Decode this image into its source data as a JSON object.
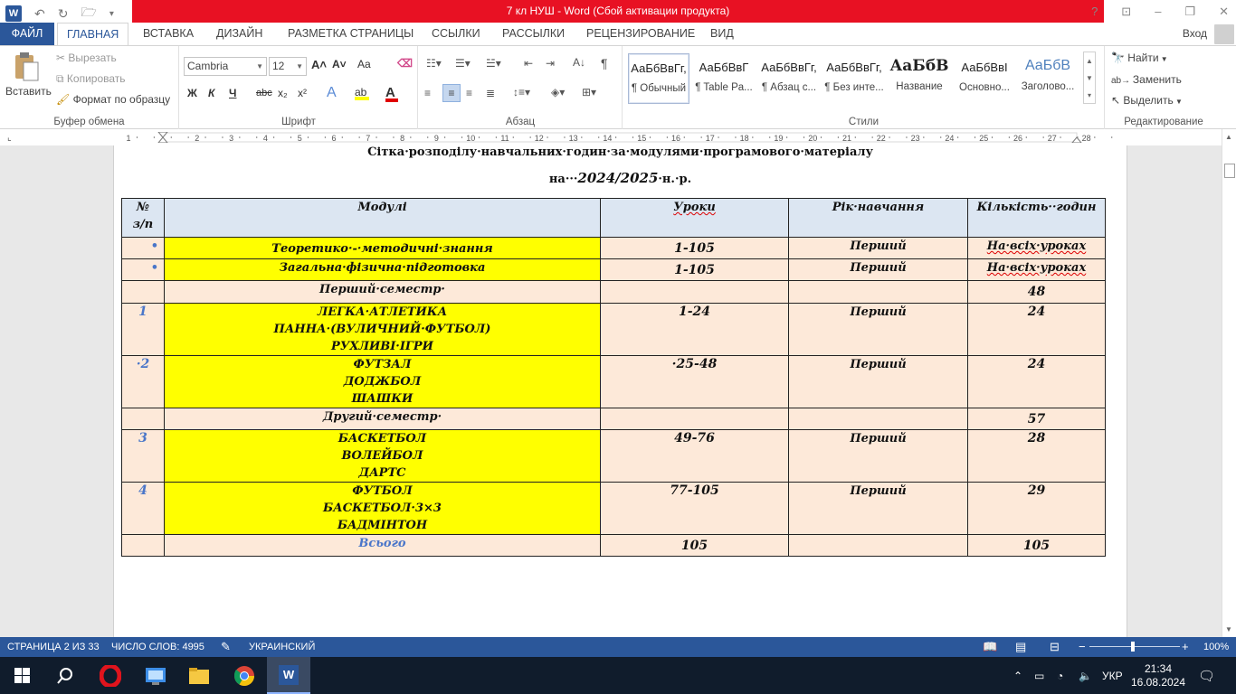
{
  "titlebar": {
    "title": "7 кл НУШ -  Word (Сбой активации продукта)",
    "help": "?",
    "ribbon_opts": "⊡",
    "minimize": "–",
    "restore": "❐",
    "close": "✕"
  },
  "tabs": {
    "file": "ФАЙЛ",
    "items": [
      "ГЛАВНАЯ",
      "ВСТАВКА",
      "ДИЗАЙН",
      "РАЗМЕТКА СТРАНИЦЫ",
      "ССЫЛКИ",
      "РАССЫЛКИ",
      "РЕЦЕНЗИРОВАНИЕ",
      "ВИД"
    ],
    "signin": "Вход"
  },
  "ribbon": {
    "clipboard": {
      "paste": "Вставить",
      "cut": "Вырезать",
      "copy": "Копировать",
      "format_painter": "Формат по образцу",
      "label": "Буфер обмена"
    },
    "font": {
      "font_name": "Cambria",
      "font_size": "12",
      "label": "Шрифт",
      "bold": "Ж",
      "italic": "К",
      "underline": "Ч",
      "strike": "abc",
      "sub": "x₂",
      "sup": "x²",
      "grow": "A˄",
      "shrink": "A˅",
      "case": "Aa",
      "effects": "A",
      "color": "A"
    },
    "paragraph": {
      "label": "Абзац",
      "pilcrow": "¶"
    },
    "styles": {
      "label": "Стили",
      "items": [
        {
          "sample": "АаБбВвГг,",
          "name": "¶ Обычный"
        },
        {
          "sample": "АаБбВвГ",
          "name": "¶ Table Pa..."
        },
        {
          "sample": "АаБбВвГг,",
          "name": "¶ Абзац с..."
        },
        {
          "sample": "АаБбВвГг,",
          "name": "¶ Без инте..."
        },
        {
          "sample": "АаБбВ",
          "name": "Название"
        },
        {
          "sample": "АаБбВвІ",
          "name": "Основно..."
        },
        {
          "sample": "АаБбВ",
          "name": "Заголово..."
        }
      ]
    },
    "editing": {
      "find": "Найти",
      "replace": "Заменить",
      "select": "Выделить",
      "label": "Редактирование"
    }
  },
  "ruler": {
    "numbers": [
      "1",
      "1",
      "2",
      "3",
      "4",
      "5",
      "6",
      "7",
      "8",
      "9",
      "10",
      "11",
      "12",
      "13",
      "14",
      "15",
      "16",
      "17",
      "18",
      "19",
      "20",
      "21",
      "22",
      "23",
      "24",
      "25",
      "26",
      "27",
      "28"
    ]
  },
  "document": {
    "title_line1": "Сітка·розподілу·навчальних·годин·за·модулями·програмового·матеріалу",
    "title_line2_prefix": "на···",
    "title_line2_year": "2024/2025",
    "title_line2_suffix": "·н.·р.",
    "table": {
      "headers": {
        "no_line1": "№",
        "no_line2": "з/п",
        "modules": "Модулі",
        "lessons": "Уроки",
        "year": "Рік·навчання",
        "hours": "Кількість··годин"
      },
      "rows": [
        {
          "no": "•",
          "module": [
            "Теоретико·-·методичні·знання"
          ],
          "lessons": "1-105",
          "year": "Перший",
          "hours": "На·всіх·уроках"
        },
        {
          "no": "•",
          "module": [
            "Загальна·фізична·підготовка"
          ],
          "lessons": "1-105",
          "year": "Перший",
          "hours": "На·всіх·уроках"
        },
        {
          "no": "",
          "module": [
            "Перший·семестр·"
          ],
          "lessons": "",
          "year": "",
          "hours": "48"
        },
        {
          "no": "1",
          "module": [
            "ЛЕГКА·АТЛЕТИКА",
            "ПАННА·(ВУЛИЧНИЙ·ФУТБОЛ)",
            "РУХЛИВІ·ІГРИ"
          ],
          "lessons": "1-24",
          "year": "Перший",
          "hours": "24"
        },
        {
          "no": "·2",
          "module": [
            "ФУТЗАЛ",
            "ДОДЖБОЛ",
            "ШАШКИ"
          ],
          "lessons": "·25-48",
          "year": "Перший",
          "hours": "24"
        },
        {
          "no": "",
          "module": [
            "Другий·семестр·"
          ],
          "lessons": "",
          "year": "",
          "hours": "57"
        },
        {
          "no": "3",
          "module": [
            "БАСКЕТБОЛ",
            "ВОЛЕЙБОЛ",
            "ДАРТС"
          ],
          "lessons": "49-76",
          "year": "Перший",
          "hours": "28"
        },
        {
          "no": "4",
          "module": [
            "ФУТБОЛ",
            "БАСКЕТБОЛ·3×3",
            "БАДМІНТОН"
          ],
          "lessons": "77-105",
          "year": "Перший",
          "hours": "29"
        },
        {
          "no": "",
          "module": [
            "Всього"
          ],
          "lessons": "105",
          "year": "",
          "hours": "105"
        }
      ]
    }
  },
  "statusbar": {
    "page": "СТРАНИЦА 2 ИЗ 33",
    "words": "ЧИСЛО СЛОВ: 4995",
    "language": "УКРАИНСКИЙ",
    "zoom": "100%"
  },
  "taskbar": {
    "lang": "УКР",
    "time": "21:34",
    "date": "16.08.2024"
  },
  "colors": {
    "word_blue": "#2b579a",
    "title_red": "#e81123",
    "header_fill": "#dce6f2",
    "row_fill": "#fde9d9",
    "highlight": "#ffff00"
  }
}
